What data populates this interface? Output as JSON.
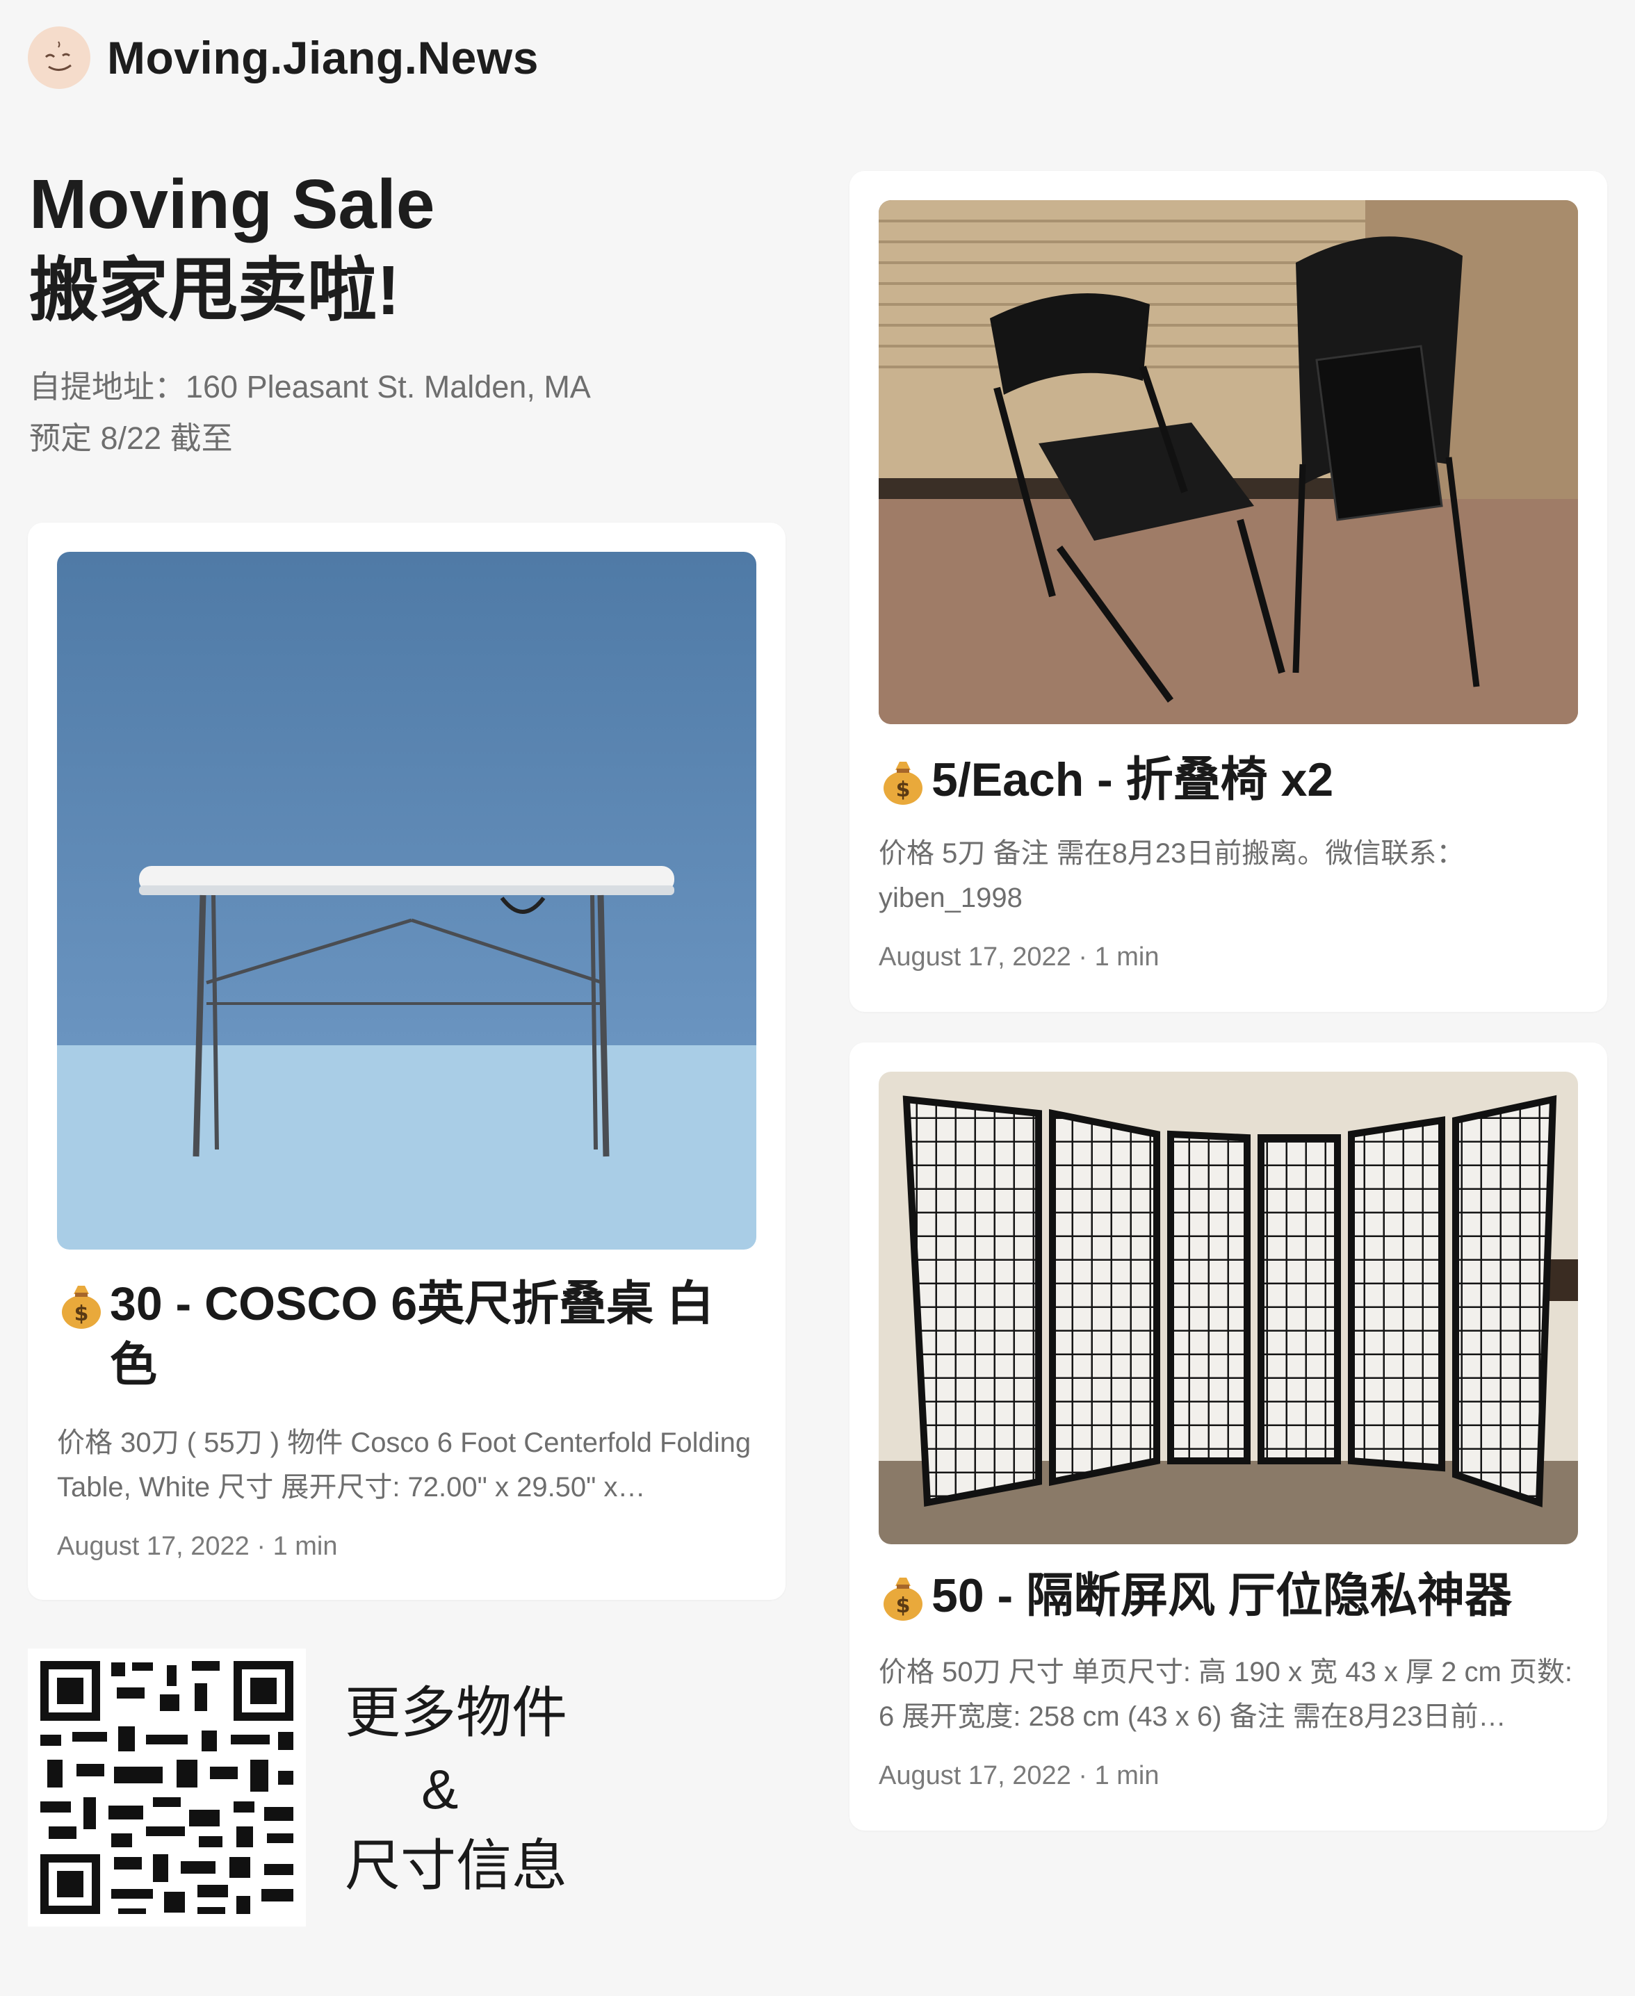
{
  "site": {
    "title": "Moving.Jiang.News",
    "logo_icon": "smiley-logo-icon"
  },
  "hero": {
    "title_line1": "Moving Sale",
    "title_line2": "搬家甩卖啦!",
    "address": "自提地址：160 Pleasant St. Malden, MA",
    "deadline": "预定 8/22 截至"
  },
  "posts": [
    {
      "icon": "money-bag-icon",
      "title": "30 - COSCO 6英尺折叠桌 白色",
      "desc": "价格 30刀 ( 55刀 ) 物件 Cosco 6 Foot Centerfold Folding Table, White 尺寸 展开尺寸: 72.00\" x 29.50\" x…",
      "date": "August 17, 2022",
      "read_time": "1 min",
      "image": "folding-table-photo"
    },
    {
      "icon": "money-bag-icon",
      "title": "5/Each - 折叠椅 x2",
      "desc": "价格 5刀 备注 需在8月23日前搬离。微信联系：yiben_1998",
      "date": "August 17, 2022",
      "read_time": "1 min",
      "image": "folding-chairs-photo"
    },
    {
      "icon": "money-bag-icon",
      "title": "50 - 隔断屏风 厅位隐私神器",
      "desc": "价格 50刀 尺寸 单页尺寸: 高 190 x 宽 43 x 厚 2 cm 页数: 6 展开宽度: 258 cm (43 x 6) 备注 需在8月23日前…",
      "date": "August 17, 2022",
      "read_time": "1 min",
      "image": "room-divider-screen-photo"
    }
  ],
  "more": {
    "line1": "更多物件",
    "line2": "&",
    "line3": "尺寸信息",
    "qr": "qr-code"
  },
  "meta_separator": " · "
}
